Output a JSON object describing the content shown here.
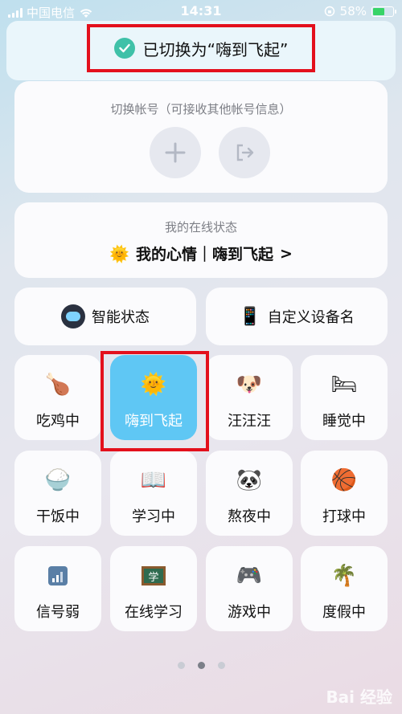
{
  "status_bar": {
    "carrier": "中国电信",
    "time": "14:31",
    "battery": "58%"
  },
  "toast": {
    "message": "已切换为“嗨到飞起”"
  },
  "account": {
    "title": "切换帐号（可接收其他帐号信息）"
  },
  "online": {
    "title": "我的在线状态",
    "mood_text": "我的心情｜嗨到飞起",
    "chevron": ">"
  },
  "wide_buttons": [
    {
      "label": "智能状态",
      "icon": "robot-icon"
    },
    {
      "label": "自定义设备名",
      "icon": "phone-icon"
    }
  ],
  "tiles": [
    {
      "label": "吃鸡中",
      "icon": "roast-chicken-icon",
      "emoji": "🍗"
    },
    {
      "label": "嗨到飞起",
      "icon": "sun-icon",
      "emoji": "🌞",
      "selected": true
    },
    {
      "label": "汪汪汪",
      "icon": "dog-icon",
      "emoji": "🐶"
    },
    {
      "label": "睡觉中",
      "icon": "bed-icon",
      "emoji": "🛏"
    },
    {
      "label": "干饭中",
      "icon": "rice-bowl-icon",
      "emoji": "🍚"
    },
    {
      "label": "学习中",
      "icon": "book-icon",
      "emoji": "📖"
    },
    {
      "label": "熬夜中",
      "icon": "panda-icon",
      "emoji": "🐼"
    },
    {
      "label": "打球中",
      "icon": "basketball-icon",
      "emoji": "🏀"
    },
    {
      "label": "信号弱",
      "icon": "signal-icon",
      "emoji": "📶"
    },
    {
      "label": "在线学习",
      "icon": "blackboard-icon",
      "emoji": "学"
    },
    {
      "label": "游戏中",
      "icon": "gamepad-icon",
      "emoji": "🎮"
    },
    {
      "label": "度假中",
      "icon": "palm-tree-icon",
      "emoji": "🌴"
    }
  ],
  "pager": {
    "count": 3,
    "active": 2
  },
  "watermark": "Bai 经验"
}
